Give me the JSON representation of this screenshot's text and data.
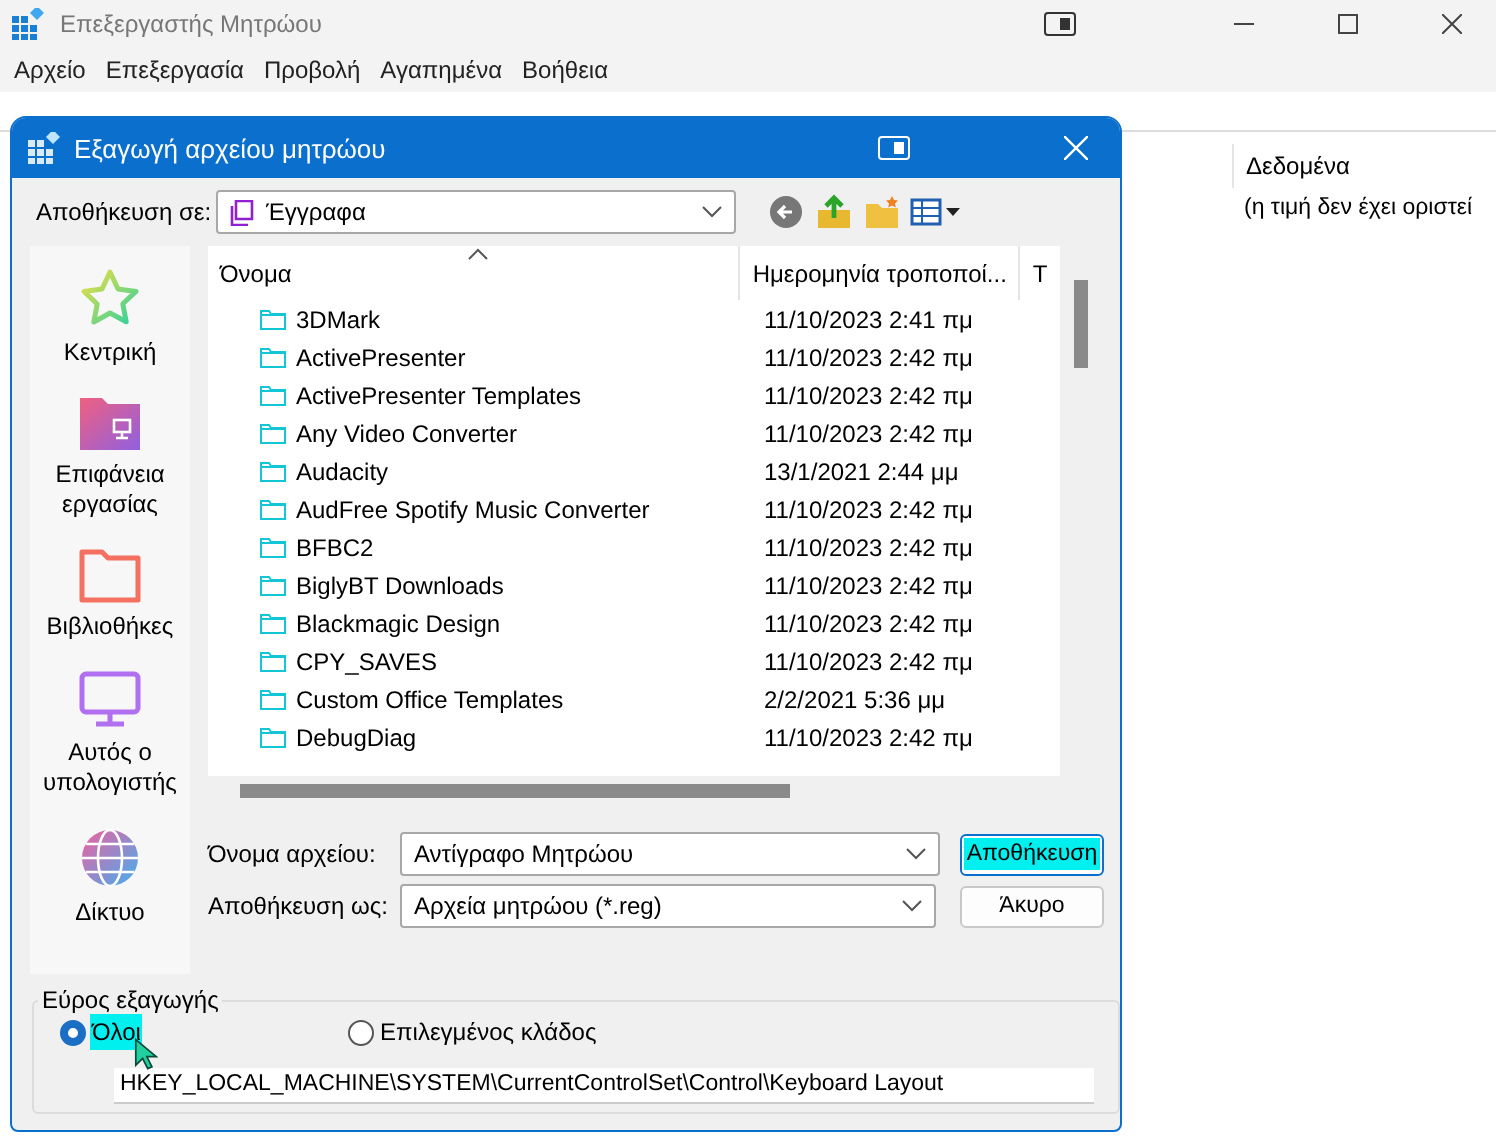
{
  "main_window": {
    "title": "Επεξεργαστής Μητρώου",
    "menu": [
      "Αρχείο",
      "Επεξεργασία",
      "Προβολή",
      "Αγαπημένα",
      "Βοήθεια"
    ],
    "columns": [
      "Δεδομένα"
    ],
    "rows": [
      [
        "(η τιμή δεν έχει οριστεί"
      ]
    ]
  },
  "dialog": {
    "title": "Εξαγωγή αρχείου μητρώου",
    "save_in_label": "Αποθήκευση σε:",
    "save_in": "Έγγραφα",
    "places": [
      {
        "kind": "home",
        "label": "Κεντρική"
      },
      {
        "kind": "desktop",
        "label": "Επιφάνεια εργασίας"
      },
      {
        "kind": "libraries",
        "label": "Βιβλιοθήκες"
      },
      {
        "kind": "computer",
        "label": "Αυτός ο υπολογιστής"
      },
      {
        "kind": "network",
        "label": "Δίκτυο"
      }
    ],
    "columns": [
      "Όνομα",
      "Ημερομηνία τροποποί...",
      "Τ"
    ],
    "files": [
      {
        "name": "3DMark",
        "modified": "11/10/2023 2:41 πμ"
      },
      {
        "name": "ActivePresenter",
        "modified": "11/10/2023 2:42 πμ"
      },
      {
        "name": "ActivePresenter Templates",
        "modified": "11/10/2023 2:42 πμ"
      },
      {
        "name": "Any Video Converter",
        "modified": "11/10/2023 2:42 πμ"
      },
      {
        "name": "Audacity",
        "modified": "13/1/2021 2:44 μμ"
      },
      {
        "name": "AudFree Spotify Music Converter",
        "modified": "11/10/2023 2:42 πμ"
      },
      {
        "name": "BFBC2",
        "modified": "11/10/2023 2:42 πμ"
      },
      {
        "name": "BiglyBT Downloads",
        "modified": "11/10/2023 2:42 πμ"
      },
      {
        "name": "Blackmagic Design",
        "modified": "11/10/2023 2:42 πμ"
      },
      {
        "name": "CPY_SAVES",
        "modified": "11/10/2023 2:42 πμ"
      },
      {
        "name": "Custom Office Templates",
        "modified": "2/2/2021 5:36 μμ"
      },
      {
        "name": "DebugDiag",
        "modified": "11/10/2023 2:42 πμ"
      }
    ],
    "file_name_label": "Όνομα αρχείου:",
    "file_name": "Αντίγραφο Μητρώου",
    "save_as_label": "Αποθήκευση ως:",
    "save_as": "Αρχεία μητρώου (*.reg)",
    "buttons": [
      {
        "label": "Αποθήκευση",
        "highlighted": true
      },
      {
        "label": "Άκυρο",
        "highlighted": false
      }
    ],
    "export_range": {
      "title": "Εύρος εξαγωγής",
      "options": [
        {
          "label": "Όλοι",
          "selected": true,
          "highlighted": true
        },
        {
          "label": "Επιλεγμένος κλάδος",
          "selected": false,
          "highlighted": false
        }
      ],
      "branch": "HKEY_LOCAL_MACHINE\\SYSTEM\\CurrentControlSet\\Control\\Keyboard Layout"
    }
  }
}
